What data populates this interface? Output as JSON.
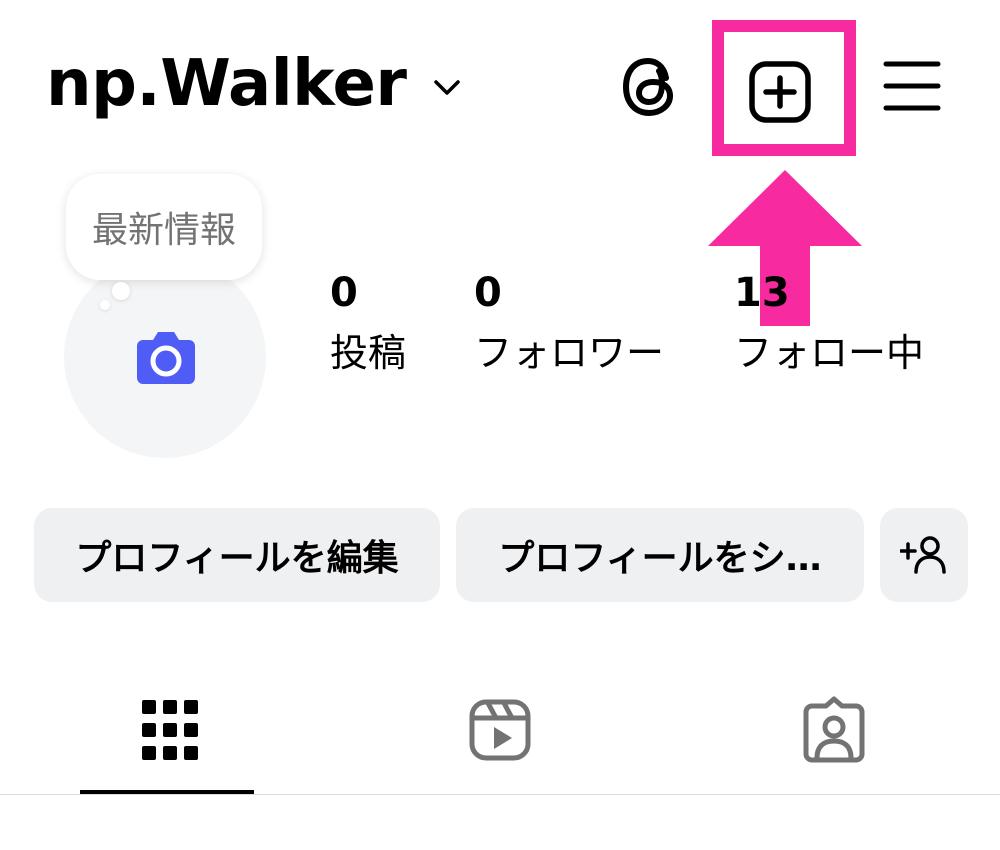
{
  "header": {
    "username": "np.Walker",
    "icons": {
      "dropdown": "chevron-down-icon",
      "threads": "threads-icon",
      "create": "plus-square-icon",
      "menu": "hamburger-menu-icon"
    }
  },
  "profile": {
    "bubble_text": "最新情報",
    "avatar_icon": "camera-icon"
  },
  "stats": [
    {
      "value": "0",
      "label": "投稿"
    },
    {
      "value": "0",
      "label": "フォロワー"
    },
    {
      "value": "13",
      "label": "フォロー中"
    }
  ],
  "actions": {
    "edit_profile": "プロフィールを編集",
    "share_profile": "プロフィールをシ…",
    "add_person_icon": "add-person-icon"
  },
  "tabs": {
    "grid": "grid-icon",
    "reels": "reels-icon",
    "tagged": "tagged-person-icon"
  },
  "colors": {
    "highlight": "#f72aa0",
    "camera": "#4f5df6",
    "button_bg": "#eff0f2",
    "tab_icon_inactive": "#737373"
  }
}
